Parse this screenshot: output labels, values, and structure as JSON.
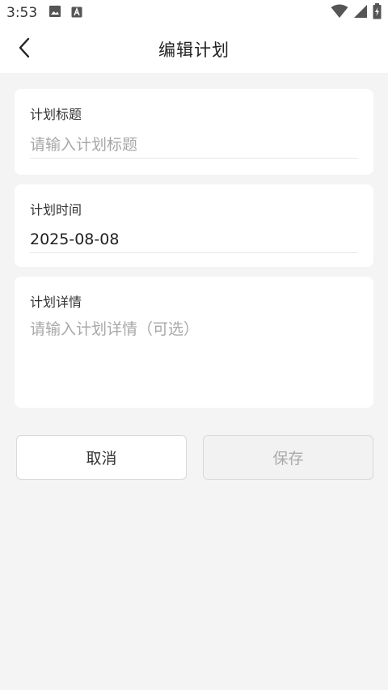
{
  "status_bar": {
    "time": "3:53",
    "icons": [
      "image-icon",
      "a-letter-icon",
      "wifi-icon",
      "signal-icon",
      "battery-icon"
    ]
  },
  "app_bar": {
    "title": "编辑计划",
    "back_icon": "chevron-left-icon"
  },
  "form": {
    "title_card": {
      "label": "计划标题",
      "placeholder": "请输入计划标题",
      "value": ""
    },
    "time_card": {
      "label": "计划时间",
      "value": "2025-08-08"
    },
    "detail_card": {
      "label": "计划详情",
      "placeholder": "请输入计划详情（可选）",
      "value": ""
    }
  },
  "actions": {
    "cancel_label": "取消",
    "save_label": "保存"
  },
  "colors": {
    "background": "#f4f4f4",
    "card": "#ffffff",
    "placeholder": "#a8a8a8",
    "disabled_text": "#aaaaaa"
  }
}
